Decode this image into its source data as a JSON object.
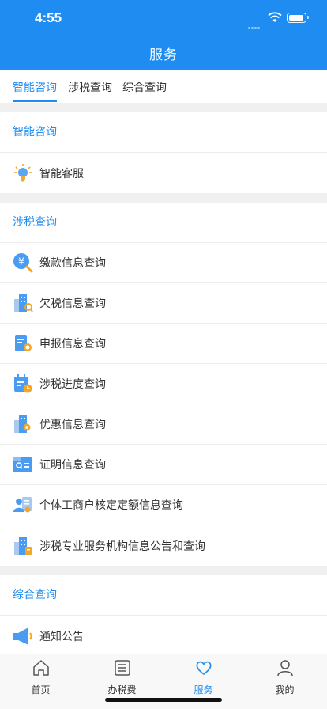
{
  "status_bar": {
    "time": "4:55"
  },
  "header": {
    "title": "服务"
  },
  "tabs": [
    {
      "label": "智能咨询",
      "active": true
    },
    {
      "label": "涉税查询",
      "active": false
    },
    {
      "label": "综合查询",
      "active": false
    }
  ],
  "sections": {
    "smart": {
      "title": "智能咨询",
      "items": [
        {
          "label": "智能客服",
          "icon": "lightbulb-icon"
        }
      ]
    },
    "tax": {
      "title": "涉税查询",
      "items": [
        {
          "label": "缴款信息查询",
          "icon": "yuan-search-icon"
        },
        {
          "label": "欠税信息查询",
          "icon": "building-search-icon"
        },
        {
          "label": "申报信息查询",
          "icon": "document-search-icon"
        },
        {
          "label": "涉税进度查询",
          "icon": "calendar-clock-icon"
        },
        {
          "label": "优惠信息查询",
          "icon": "building-discount-icon"
        },
        {
          "label": "证明信息查询",
          "icon": "certificate-search-icon"
        },
        {
          "label": "个体工商户核定定额信息查询",
          "icon": "person-card-icon"
        },
        {
          "label": "涉税专业服务机构信息公告和查询",
          "icon": "building-info-icon"
        }
      ]
    },
    "general": {
      "title": "综合查询",
      "items": [
        {
          "label": "通知公告",
          "icon": "megaphone-icon"
        }
      ]
    }
  },
  "tabbar": [
    {
      "label": "首页",
      "icon": "home-icon",
      "active": false
    },
    {
      "label": "办税费",
      "icon": "list-icon",
      "active": false
    },
    {
      "label": "服务",
      "icon": "heart-icon",
      "active": true
    },
    {
      "label": "我的",
      "icon": "person-icon",
      "active": false
    }
  ],
  "colors": {
    "primary": "#1e8cf0",
    "orange": "#f5a623"
  }
}
